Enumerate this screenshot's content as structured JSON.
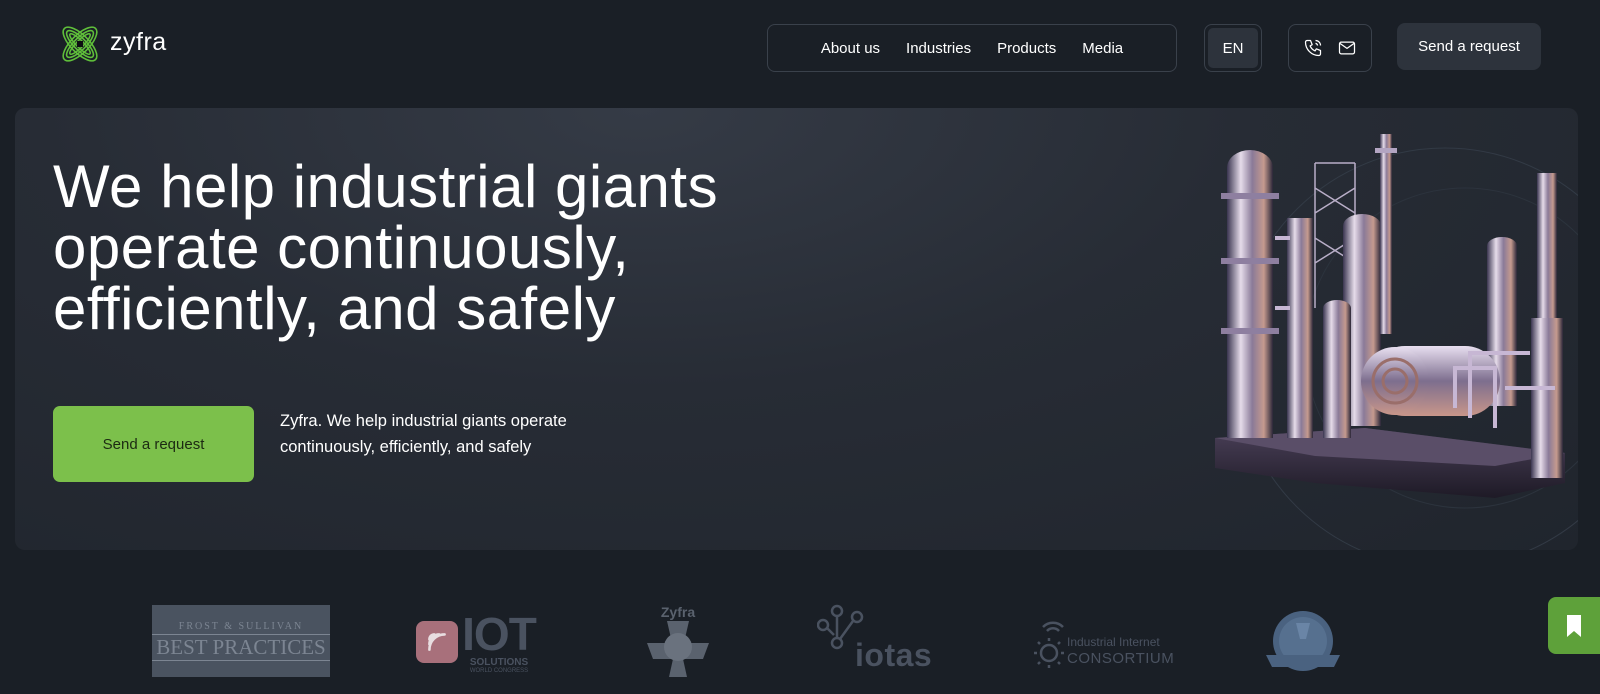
{
  "brand": {
    "name": "zyfra",
    "accent": "#7cc04b"
  },
  "nav": {
    "items": [
      "About us",
      "Industries",
      "Products",
      "Media"
    ]
  },
  "header": {
    "language": "EN",
    "request_label": "Send a request"
  },
  "hero": {
    "title_lines": [
      "We help industrial giants",
      "operate continuously,",
      "efficiently, and safely"
    ],
    "button_label": "Send a request",
    "subtitle": "Zyfra. We help industrial giants operate continuously, efficiently, and safely"
  },
  "partners": {
    "frost": {
      "line1": "FROST & SULLIVAN",
      "line2": "BEST PRACTICES"
    },
    "iot": {
      "big": "IOT",
      "sub1": "SOLUTIONS",
      "sub2": "WORLD CONGRESS"
    },
    "zyfra_award": {
      "label": "Zyfra"
    },
    "iotas": {
      "label": "iotas"
    },
    "iic": {
      "line1": "Industrial Internet",
      "line2": "CONSORTIUM"
    }
  },
  "icons": [
    "phone-icon",
    "mail-icon",
    "bookmark-icon"
  ]
}
